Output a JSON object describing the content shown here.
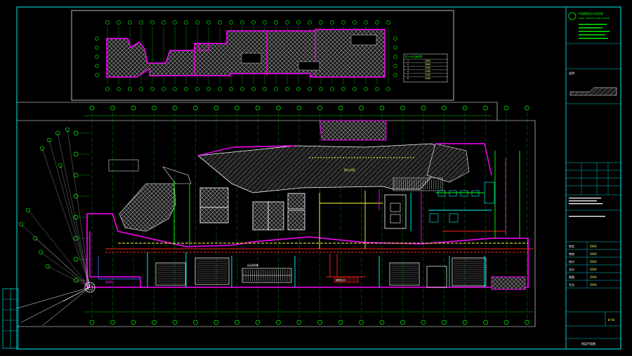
{
  "colors": {
    "background": "#000000",
    "frame": "#00c8c8",
    "grid": "#ffffff",
    "dim": "#00ff00",
    "zone_boundary": "#ff00ff",
    "hatch": "#c0c0c0",
    "pipe_red": "#ff2020",
    "pipe_yellow": "#ffff40",
    "pipe_cyan": "#00ffff",
    "pipe_blue": "#4060ff",
    "text_label": "#ffffff",
    "title_text": "#00ff00"
  },
  "title_block": {
    "company": "中国建筑设计研究院",
    "company_sub": "CHINA ARCHITECTURE DESIGN",
    "section_label": "说明",
    "sheet_title": "首层平面图",
    "sheet_no": "W-01",
    "rows": [
      {
        "label": "审定",
        "value": "XXXX"
      },
      {
        "label": "审核",
        "value": "XXXX"
      },
      {
        "label": "校对",
        "value": "XXXX"
      },
      {
        "label": "设计",
        "value": "XXXX"
      },
      {
        "label": "制图",
        "value": "XXXX"
      },
      {
        "label": "专业",
        "value": "XXXX"
      }
    ]
  },
  "key_plan": {
    "legend_title": "防火分区面积表",
    "legend_rows": [
      {
        "zone": "1",
        "area": "4600"
      },
      {
        "zone": "2",
        "area": "3800"
      },
      {
        "zone": "3",
        "area": "2500"
      },
      {
        "zone": "4",
        "area": "4200"
      },
      {
        "zone": "5",
        "area": "3100"
      },
      {
        "zone": "6",
        "area": "1800"
      }
    ]
  },
  "plan": {
    "main_label": "防火分区",
    "escalator_label": "自动扶梯",
    "stair_label": "楼梯间",
    "fire_exit_label": "消防出口"
  },
  "icons": {
    "north_arrow": "north-arrow-icon",
    "grid_bubble": "grid-bubble-icon"
  }
}
